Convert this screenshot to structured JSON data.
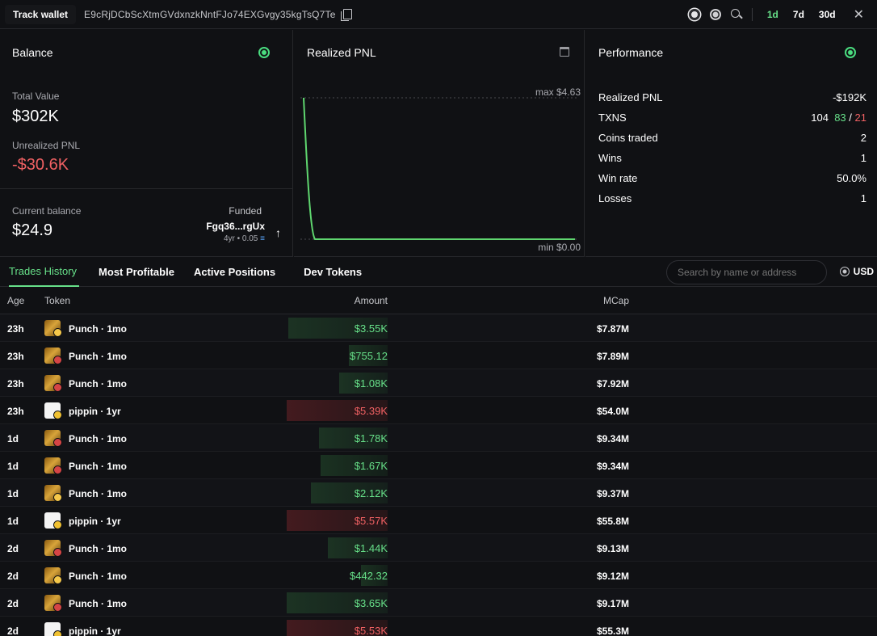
{
  "header": {
    "track_label": "Track wallet",
    "wallet_address": "E9cRjDCbScXtmGVdxnzkNntFJo74EXGvgy35kgTsQ7Te",
    "timeframes": [
      "1d",
      "7d",
      "30d"
    ],
    "active_timeframe": "1d"
  },
  "balance": {
    "title": "Balance",
    "total_value_label": "Total Value",
    "total_value": "$302K",
    "unrealized_label": "Unrealized PNL",
    "unrealized_value": "-$30.6K",
    "current_label": "Current balance",
    "current_value": "$24.9",
    "funded_label": "Funded",
    "funded_address": "Fgq36...rgUx",
    "funded_meta": "4yr • 0.05"
  },
  "realized": {
    "title": "Realized PNL",
    "max_label": "max $4.63",
    "min_label": "min $0.00"
  },
  "performance": {
    "title": "Performance",
    "realized_label": "Realized PNL",
    "realized_value": "-$192K",
    "txns_label": "TXNS",
    "txns_total": "104",
    "txns_buys": "83",
    "txns_sep": "/",
    "txns_sells": "21",
    "coins_label": "Coins traded",
    "coins_value": "2",
    "wins_label": "Wins",
    "wins_value": "1",
    "winrate_label": "Win rate",
    "winrate_value": "50.0%",
    "losses_label": "Losses",
    "losses_value": "1"
  },
  "tabs": {
    "trades": "Trades History",
    "profitable": "Most Profitable",
    "active": "Active Positions",
    "dev": "Dev Tokens",
    "search_placeholder": "Search by name or address",
    "currency": "USD"
  },
  "table": {
    "headers": {
      "age": "Age",
      "token": "Token",
      "amount": "Amount",
      "mcap": "MCap"
    },
    "rows": [
      {
        "age": "23h",
        "token": "Punch · 1mo",
        "amount": "$3.55K",
        "mcap": "$7.87M",
        "side": "buy",
        "bar": 0.98
      },
      {
        "age": "23h",
        "token": "Punch · 1mo",
        "amount": "$755.12",
        "mcap": "$7.89M",
        "side": "buy",
        "bar": 0.38
      },
      {
        "age": "23h",
        "token": "Punch · 1mo",
        "amount": "$1.08K",
        "mcap": "$7.92M",
        "side": "buy",
        "bar": 0.48
      },
      {
        "age": "23h",
        "token": "pippin · 1yr",
        "amount": "$5.39K",
        "mcap": "$54.0M",
        "side": "sell",
        "bar": 1.0
      },
      {
        "age": "1d",
        "token": "Punch · 1mo",
        "amount": "$1.78K",
        "mcap": "$9.34M",
        "side": "buy",
        "bar": 0.68
      },
      {
        "age": "1d",
        "token": "Punch · 1mo",
        "amount": "$1.67K",
        "mcap": "$9.34M",
        "side": "buy",
        "bar": 0.66
      },
      {
        "age": "1d",
        "token": "Punch · 1mo",
        "amount": "$2.12K",
        "mcap": "$9.37M",
        "side": "buy",
        "bar": 0.76
      },
      {
        "age": "1d",
        "token": "pippin · 1yr",
        "amount": "$5.57K",
        "mcap": "$55.8M",
        "side": "sell",
        "bar": 1.0
      },
      {
        "age": "2d",
        "token": "Punch · 1mo",
        "amount": "$1.44K",
        "mcap": "$9.13M",
        "side": "buy",
        "bar": 0.59
      },
      {
        "age": "2d",
        "token": "Punch · 1mo",
        "amount": "$442.32",
        "mcap": "$9.12M",
        "side": "buy",
        "bar": 0.26
      },
      {
        "age": "2d",
        "token": "Punch · 1mo",
        "amount": "$3.65K",
        "mcap": "$9.17M",
        "side": "buy",
        "bar": 1.0
      },
      {
        "age": "2d",
        "token": "pippin · 1yr",
        "amount": "$5.53K",
        "mcap": "$55.3M",
        "side": "sell",
        "bar": 1.0
      }
    ]
  },
  "colors": {
    "green": "#67e089",
    "red": "#f06163",
    "background": "#101114"
  }
}
